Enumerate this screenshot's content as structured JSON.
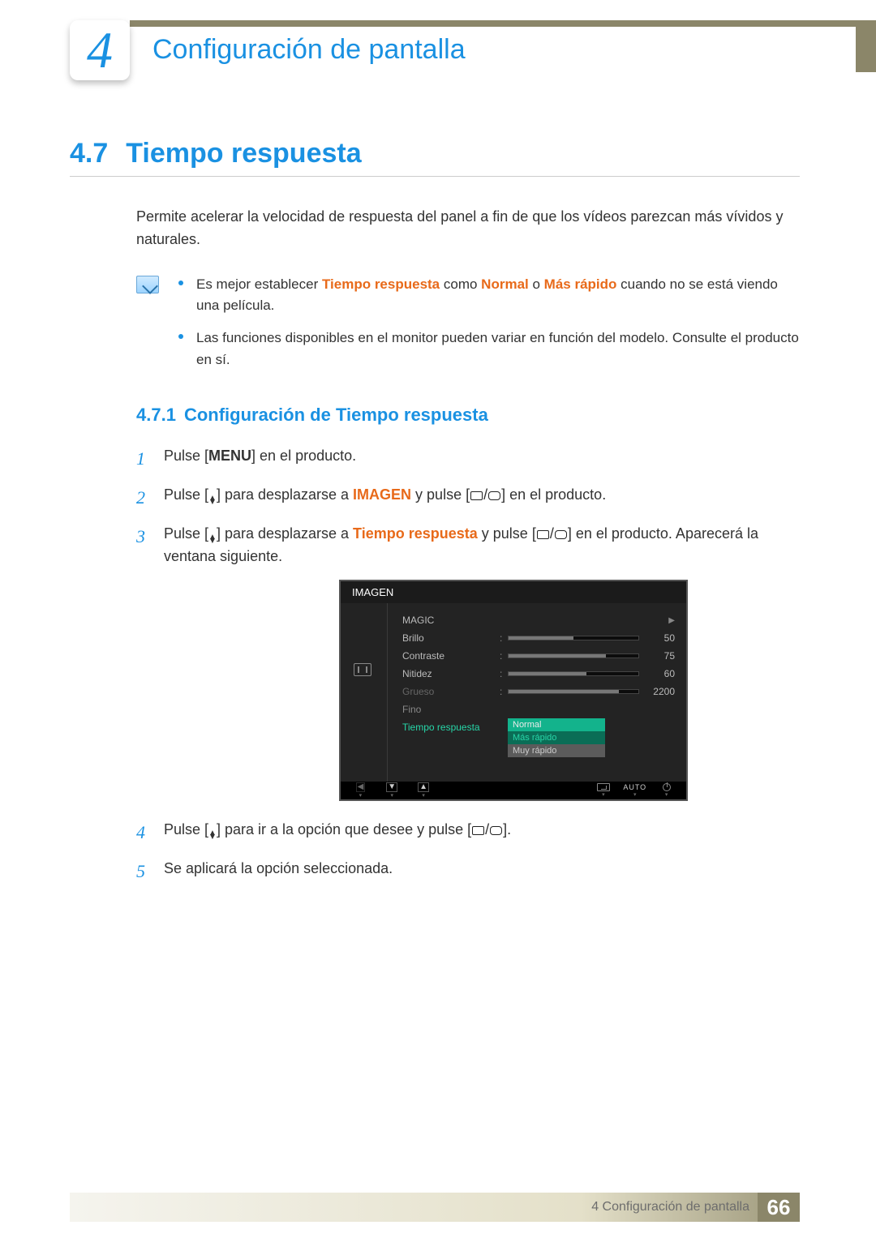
{
  "chapter": {
    "number": "4",
    "title": "Configuración de pantalla"
  },
  "section": {
    "number": "4.7",
    "title": "Tiempo respuesta"
  },
  "intro": "Permite acelerar la velocidad de respuesta del panel a fin de que los vídeos parezcan más vívidos y naturales.",
  "notes": {
    "b1_a": "Es mejor establecer ",
    "b1_hl1": "Tiempo respuesta",
    "b1_b": " como ",
    "b1_hl2": "Normal",
    "b1_c": " o ",
    "b1_hl3": "Más rápido",
    "b1_d": " cuando no se está viendo una película.",
    "b2": "Las funciones disponibles en el monitor pueden variar en función del modelo. Consulte el producto en sí."
  },
  "subsection": {
    "number": "4.7.1",
    "title": "Configuración de Tiempo respuesta"
  },
  "steps": {
    "s1_a": "Pulse [",
    "s1_menu": "MENU",
    "s1_b": "] en el producto.",
    "s2_a": "Pulse [",
    "s2_b": "] para desplazarse a ",
    "s2_hl": "IMAGEN",
    "s2_c": " y pulse [",
    "s2_d": "] en el producto.",
    "s3_a": "Pulse [",
    "s3_b": "] para desplazarse a ",
    "s3_hl": "Tiempo respuesta",
    "s3_c": " y pulse [",
    "s3_d": "] en el producto. Aparecerá la ventana siguiente.",
    "s4_a": "Pulse [",
    "s4_b": "] para ir a la opción que desee y pulse [",
    "s4_c": "].",
    "s5": "Se aplicará la opción seleccionada."
  },
  "osd": {
    "title": "IMAGEN",
    "rows": {
      "magic": "MAGIC",
      "brillo": {
        "label": "Brillo",
        "value": "50",
        "fill": 50
      },
      "contraste": {
        "label": "Contraste",
        "value": "75",
        "fill": 75
      },
      "nitidez": {
        "label": "Nitidez",
        "value": "60",
        "fill": 60
      },
      "grueso": {
        "label": "Grueso",
        "value": "2200",
        "fill": 85
      },
      "fino": {
        "label": "Fino"
      },
      "tiempo": {
        "label": "Tiempo respuesta"
      }
    },
    "dropdown": {
      "opt1": "Normal",
      "opt2": "Más rápido",
      "opt3": "Muy rápido"
    },
    "nav": {
      "auto": "AUTO"
    }
  },
  "footer": {
    "text": "4 Configuración de pantalla",
    "page": "66"
  }
}
